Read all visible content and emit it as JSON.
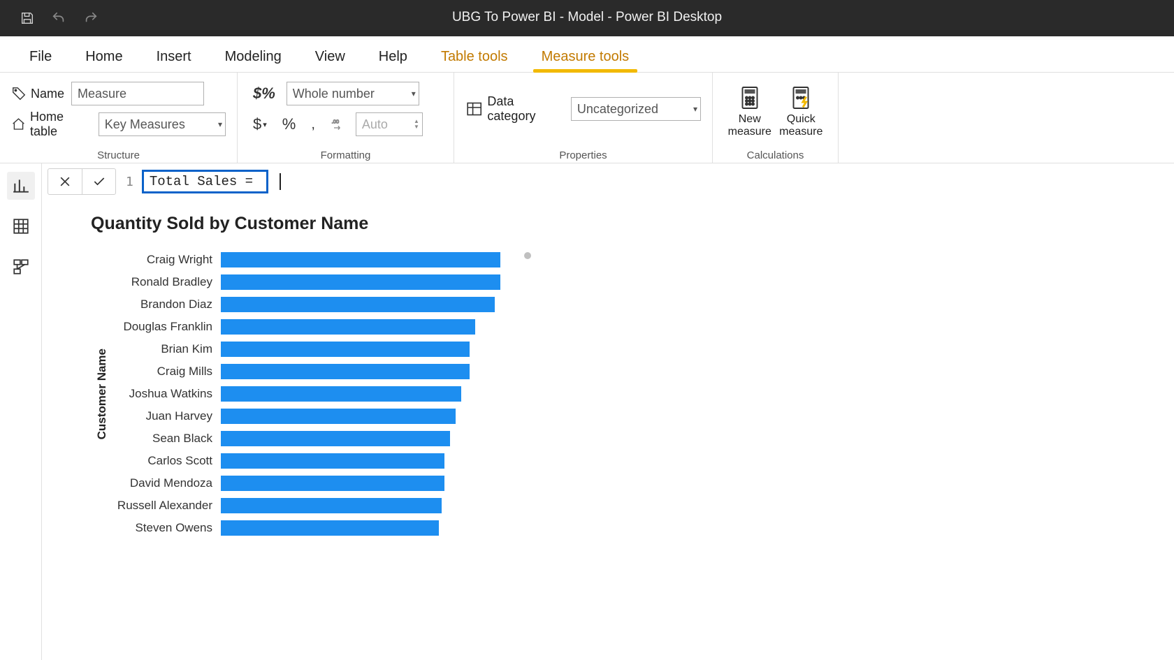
{
  "app_title": "UBG To Power BI - Model - Power BI Desktop",
  "tabs": {
    "file": "File",
    "home": "Home",
    "insert": "Insert",
    "modeling": "Modeling",
    "view": "View",
    "help": "Help",
    "table_tools": "Table tools",
    "measure_tools": "Measure tools"
  },
  "ribbon": {
    "structure": {
      "name_label": "Name",
      "name_value": "Measure",
      "home_table_label": "Home table",
      "home_table_value": "Key Measures",
      "group_label": "Structure"
    },
    "formatting": {
      "format_value": "Whole number",
      "decimals_placeholder": "Auto",
      "group_label": "Formatting"
    },
    "properties": {
      "data_category_label": "Data category",
      "data_category_value": "Uncategorized",
      "group_label": "Properties"
    },
    "calculations": {
      "new_measure": "New measure",
      "quick_measure": "Quick measure",
      "group_label": "Calculations"
    }
  },
  "formula": {
    "line": "1",
    "text": "Total Sales = "
  },
  "chart_data": {
    "type": "bar",
    "title": "Quantity Sold by Customer Name",
    "ylabel": "Customer Name",
    "xlabel": "",
    "categories": [
      "Craig Wright",
      "Ronald Bradley",
      "Brandon Diaz",
      "Douglas Franklin",
      "Brian Kim",
      "Craig Mills",
      "Joshua Watkins",
      "Juan Harvey",
      "Sean Black",
      "Carlos Scott",
      "David Mendoza",
      "Russell Alexander",
      "Steven Owens"
    ],
    "values": [
      100,
      100,
      98,
      91,
      89,
      89,
      86,
      84,
      82,
      80,
      80,
      79,
      78
    ],
    "ylim": [
      0,
      100
    ]
  }
}
